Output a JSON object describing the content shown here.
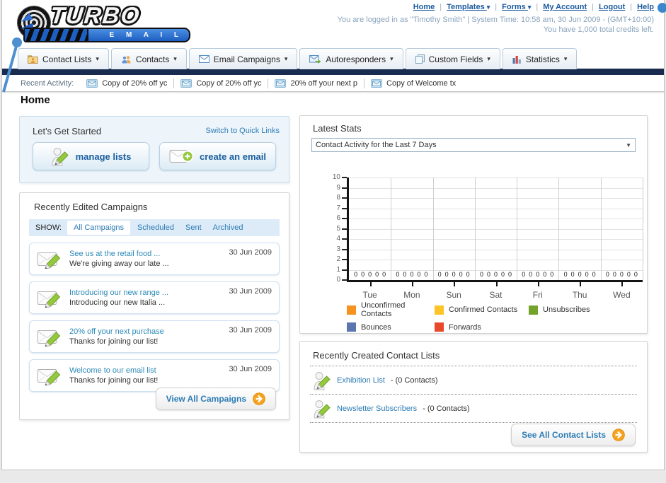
{
  "header": {
    "logo": {
      "line1": "TURBO",
      "line2": "E M A I L"
    },
    "nav_links": [
      "Home",
      "Templates",
      "Forms",
      "My Account",
      "Logout",
      "Help"
    ],
    "nav_dropdowns": [
      "Templates",
      "Forms"
    ],
    "login_line": "You are logged in as \"Timothy Smith\" | System Time: 10:58 am, 30 Jun 2009 - (GMT+10:00)",
    "credits_line": "You have 1,000 total credits left."
  },
  "nav_tabs": [
    {
      "label": "Contact Lists",
      "icon": "folder-contacts-icon"
    },
    {
      "label": "Contacts",
      "icon": "contacts-icon"
    },
    {
      "label": "Email Campaigns",
      "icon": "envelope-icon"
    },
    {
      "label": "Autoresponders",
      "icon": "envelope-arrow-icon"
    },
    {
      "label": "Custom Fields",
      "icon": "documents-icon"
    },
    {
      "label": "Statistics",
      "icon": "bar-chart-icon"
    }
  ],
  "recent_activity": {
    "label": "Recent Activity:",
    "items": [
      "Copy of 20% off yc",
      "Copy of 20% off yc",
      "20% off your next p",
      "Copy of Welcome tx"
    ]
  },
  "page_title": "Home",
  "get_started": {
    "title": "Let's Get Started",
    "switch_link": "Switch to Quick Links",
    "buttons": [
      {
        "label": "manage lists",
        "icon": "person-pencil-icon"
      },
      {
        "label": "create an email",
        "icon": "envelope-plus-icon"
      }
    ]
  },
  "campaigns": {
    "title": "Recently Edited Campaigns",
    "show_label": "SHOW:",
    "filters": [
      "All Campaigns",
      "Scheduled",
      "Sent",
      "Archived"
    ],
    "active_filter": "All Campaigns",
    "items": [
      {
        "title": "See us at the retail food ...",
        "subtitle": "We're giving away our late ...",
        "date": "30 Jun 2009"
      },
      {
        "title": "Introducing our new range ...",
        "subtitle": "Introducing our new Italia ...",
        "date": "30 Jun 2009"
      },
      {
        "title": "20% off your next purchase",
        "subtitle": "Thanks for joining our list!",
        "date": "30 Jun 2009"
      },
      {
        "title": "Welcome to our email list",
        "subtitle": "Thanks for joining our list!",
        "date": "30 Jun 2009"
      }
    ],
    "view_all_label": "View All Campaigns"
  },
  "stats": {
    "title": "Latest Stats",
    "dropdown_value": "Contact Activity for the Last 7 Days"
  },
  "chart_data": {
    "type": "bar",
    "title": "Contact Activity for the Last 7 Days",
    "categories": [
      "Tue",
      "Mon",
      "Sun",
      "Sat",
      "Fri",
      "Thu",
      "Wed"
    ],
    "series": [
      {
        "name": "Unconfirmed Contacts",
        "color": "#f6921e",
        "values": [
          0,
          0,
          0,
          0,
          0,
          0,
          0
        ]
      },
      {
        "name": "Confirmed Contacts",
        "color": "#fcc426",
        "values": [
          0,
          0,
          0,
          0,
          0,
          0,
          0
        ]
      },
      {
        "name": "Unsubscribes",
        "color": "#74a32c",
        "values": [
          0,
          0,
          0,
          0,
          0,
          0,
          0
        ]
      },
      {
        "name": "Bounces",
        "color": "#5b76af",
        "values": [
          0,
          0,
          0,
          0,
          0,
          0,
          0
        ]
      },
      {
        "name": "Forwards",
        "color": "#e8492a",
        "values": [
          0,
          0,
          0,
          0,
          0,
          0,
          0
        ]
      }
    ],
    "xlabel": "",
    "ylabel": "",
    "ylim": [
      0,
      10
    ],
    "yticks": [
      0,
      1,
      2,
      3,
      4,
      5,
      6,
      7,
      8,
      9,
      10
    ],
    "grid": true,
    "legend_position": "bottom",
    "bar_value_labels": "0 shown five times per day (one per series)"
  },
  "contact_lists": {
    "title": "Recently Created Contact Lists",
    "items": [
      {
        "name": "Exhibition List",
        "detail": " - (0 Contacts)"
      },
      {
        "name": "Newsletter Subscribers",
        "detail": " - (0 Contacts)"
      }
    ],
    "see_all_label": "See All Contact Lists"
  },
  "colors": {
    "navy_bar": "#1a2b50",
    "link_blue": "#2d7cb5",
    "header_link_blue": "#1b5a9e",
    "button_text_blue": "#1b5e9e",
    "pencil_green": "#94c83d",
    "arrow_orange": "#f6a21c",
    "panel_blue_bg": "#edf5fb",
    "show_bar_bg": "#dcebf7"
  }
}
